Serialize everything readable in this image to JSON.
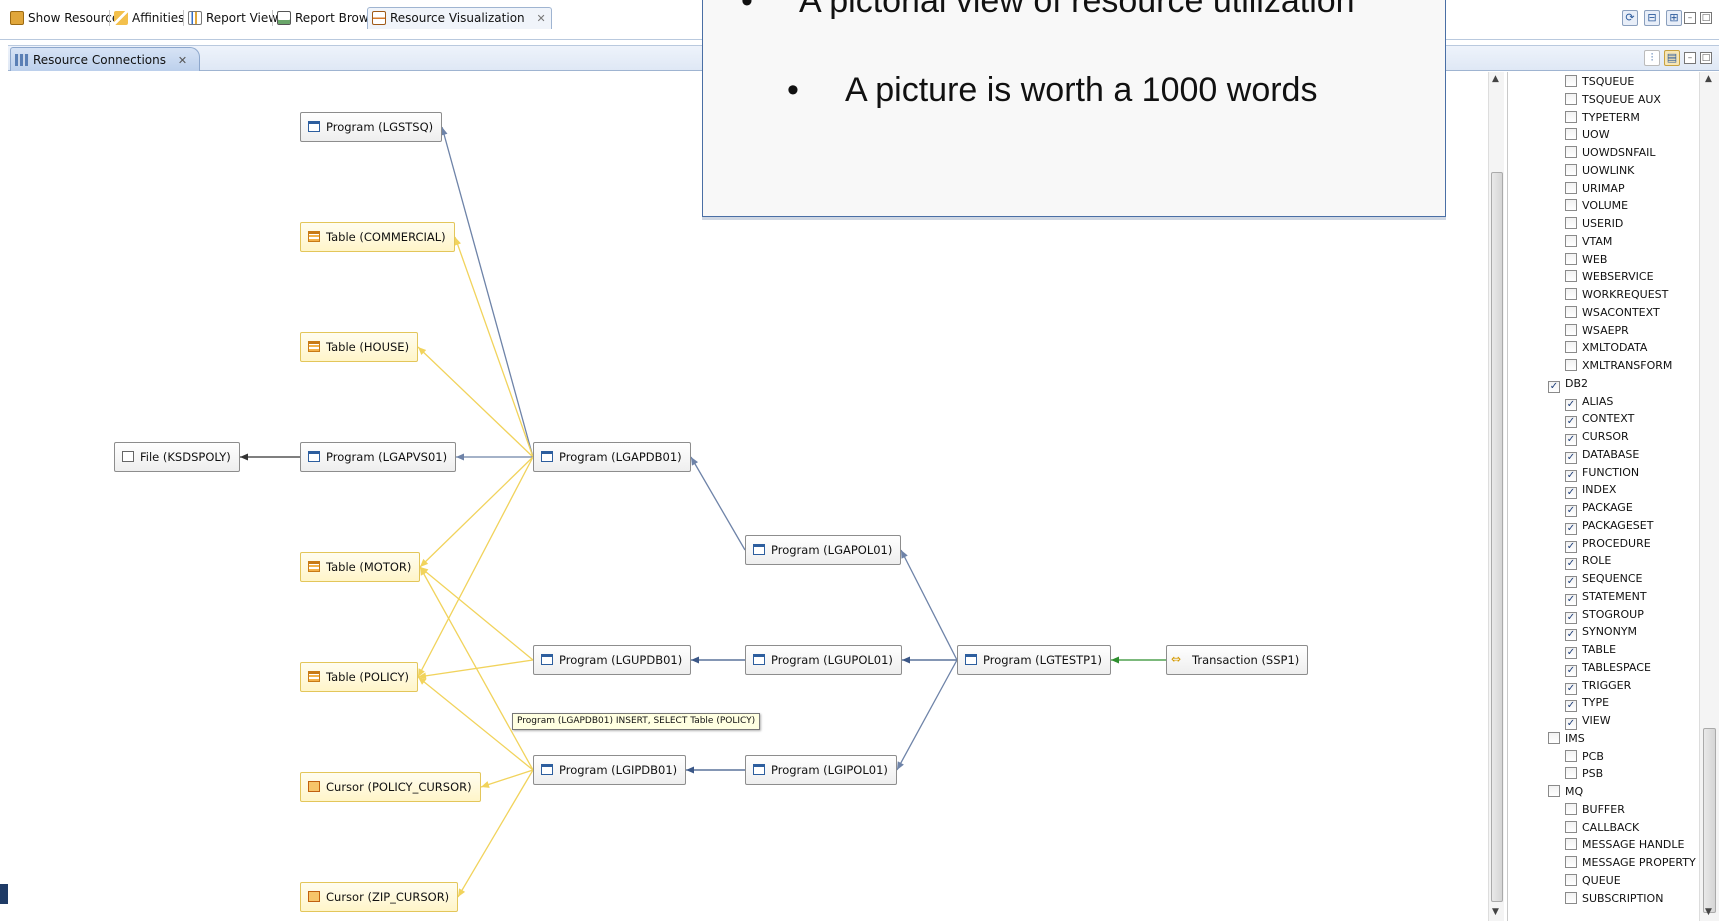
{
  "top_tabs": [
    {
      "label": "Show Resources",
      "icon": "show-resources-icon",
      "color": "#c78a1a"
    },
    {
      "label": "Affinities",
      "icon": "affinities-icon",
      "color": "#d99a1a"
    },
    {
      "label": "Report View",
      "icon": "report-view-icon",
      "color": "#2d6bc7"
    },
    {
      "label": "Report Browser",
      "icon": "report-browser-icon",
      "color": "#3f7f3f"
    },
    {
      "label": "Resource Visualization",
      "icon": "resource-visualization-icon",
      "color": "#c0722a",
      "active": true
    }
  ],
  "view_tab": {
    "label": "Resource Connections"
  },
  "overlay": {
    "bullets": [
      "A pictorial view of resource utilization",
      "A picture is worth a 1000 words"
    ]
  },
  "nodes": [
    {
      "id": "lgstsq",
      "label": "Program (LGSTSQ)",
      "kind": "program"
    },
    {
      "id": "commercial",
      "label": "Table (COMMERCIAL)",
      "kind": "table"
    },
    {
      "id": "house",
      "label": "Table (HOUSE)",
      "kind": "table"
    },
    {
      "id": "ksdspoly",
      "label": "File (KSDSPOLY)",
      "kind": "file"
    },
    {
      "id": "lgapvs01",
      "label": "Program (LGAPVS01)",
      "kind": "program"
    },
    {
      "id": "lgapdb01",
      "label": "Program (LGAPDB01)",
      "kind": "program"
    },
    {
      "id": "motor",
      "label": "Table (MOTOR)",
      "kind": "table"
    },
    {
      "id": "lgapol01",
      "label": "Program (LGAPOL01)",
      "kind": "program"
    },
    {
      "id": "policy",
      "label": "Table (POLICY)",
      "kind": "table"
    },
    {
      "id": "lgupdb01",
      "label": "Program (LGUPDB01)",
      "kind": "program"
    },
    {
      "id": "lgupol01",
      "label": "Program (LGUPOL01)",
      "kind": "program"
    },
    {
      "id": "lgtestp1",
      "label": "Program (LGTESTP1)",
      "kind": "program"
    },
    {
      "id": "ssp1",
      "label": "Transaction (SSP1)",
      "kind": "transaction"
    },
    {
      "id": "policy_cursor",
      "label": "Cursor (POLICY_CURSOR)",
      "kind": "cursor"
    },
    {
      "id": "lgipdb01",
      "label": "Program (LGIPDB01)",
      "kind": "program"
    },
    {
      "id": "lgipol01",
      "label": "Program (LGIPOL01)",
      "kind": "program"
    },
    {
      "id": "zip_cursor",
      "label": "Cursor (ZIP_CURSOR)",
      "kind": "cursor"
    }
  ],
  "edges": [
    {
      "from": "lgapdb01",
      "to": "lgstsq",
      "color": "#6e83a8"
    },
    {
      "from": "lgapdb01",
      "to": "commercial",
      "color": "#f1d35c"
    },
    {
      "from": "lgapdb01",
      "to": "house",
      "color": "#f1d35c"
    },
    {
      "from": "lgapdb01",
      "to": "lgapvs01",
      "color": "#6e83a8"
    },
    {
      "from": "lgapvs01",
      "to": "ksdspoly",
      "color": "#333333"
    },
    {
      "from": "lgapdb01",
      "to": "motor",
      "color": "#f1d35c"
    },
    {
      "from": "lgapdb01",
      "to": "policy",
      "color": "#f1d35c"
    },
    {
      "from": "lgapol01",
      "to": "lgapdb01",
      "color": "#6e83a8"
    },
    {
      "from": "lgupdb01",
      "to": "motor",
      "color": "#f1d35c"
    },
    {
      "from": "lgupdb01",
      "to": "policy",
      "color": "#f1d35c"
    },
    {
      "from": "lgupol01",
      "to": "lgupdb01",
      "color": "#3b5787"
    },
    {
      "from": "lgtestp1",
      "to": "lgupol01",
      "color": "#3b5787"
    },
    {
      "from": "lgtestp1",
      "to": "lgapol01",
      "color": "#6e83a8"
    },
    {
      "from": "lgtestp1",
      "to": "lgipol01",
      "color": "#6e83a8"
    },
    {
      "from": "ssp1",
      "to": "lgtestp1",
      "color": "#2f8f2f"
    },
    {
      "from": "lgipdb01",
      "to": "policy",
      "color": "#f1d35c"
    },
    {
      "from": "lgipdb01",
      "to": "motor",
      "color": "#f1d35c"
    },
    {
      "from": "lgipdb01",
      "to": "policy_cursor",
      "color": "#f1d35c"
    },
    {
      "from": "lgipdb01",
      "to": "zip_cursor",
      "color": "#f1d35c"
    },
    {
      "from": "lgipol01",
      "to": "lgipdb01",
      "color": "#3b5787"
    }
  ],
  "tooltip": {
    "text": "Program (LGAPDB01) INSERT, SELECT Table (POLICY)"
  },
  "tree": [
    {
      "label": "TSQUEUE",
      "level": 1,
      "checked": false
    },
    {
      "label": "TSQUEUE AUX",
      "level": 1,
      "checked": false
    },
    {
      "label": "TYPETERM",
      "level": 1,
      "checked": false
    },
    {
      "label": "UOW",
      "level": 1,
      "checked": false
    },
    {
      "label": "UOWDSNFAIL",
      "level": 1,
      "checked": false
    },
    {
      "label": "UOWLINK",
      "level": 1,
      "checked": false
    },
    {
      "label": "URIMAP",
      "level": 1,
      "checked": false
    },
    {
      "label": "VOLUME",
      "level": 1,
      "checked": false
    },
    {
      "label": "USERID",
      "level": 1,
      "checked": false
    },
    {
      "label": "VTAM",
      "level": 1,
      "checked": false
    },
    {
      "label": "WEB",
      "level": 1,
      "checked": false
    },
    {
      "label": "WEBSERVICE",
      "level": 1,
      "checked": false
    },
    {
      "label": "WORKREQUEST",
      "level": 1,
      "checked": false
    },
    {
      "label": "WSACONTEXT",
      "level": 1,
      "checked": false
    },
    {
      "label": "WSAEPR",
      "level": 1,
      "checked": false
    },
    {
      "label": "XMLTODATA",
      "level": 1,
      "checked": false
    },
    {
      "label": "XMLTRANSFORM",
      "level": 1,
      "checked": false
    },
    {
      "label": "DB2",
      "level": 0,
      "checked": true
    },
    {
      "label": "ALIAS",
      "level": 1,
      "checked": true
    },
    {
      "label": "CONTEXT",
      "level": 1,
      "checked": true
    },
    {
      "label": "CURSOR",
      "level": 1,
      "checked": true
    },
    {
      "label": "DATABASE",
      "level": 1,
      "checked": true
    },
    {
      "label": "FUNCTION",
      "level": 1,
      "checked": true
    },
    {
      "label": "INDEX",
      "level": 1,
      "checked": true
    },
    {
      "label": "PACKAGE",
      "level": 1,
      "checked": true
    },
    {
      "label": "PACKAGESET",
      "level": 1,
      "checked": true
    },
    {
      "label": "PROCEDURE",
      "level": 1,
      "checked": true
    },
    {
      "label": "ROLE",
      "level": 1,
      "checked": true
    },
    {
      "label": "SEQUENCE",
      "level": 1,
      "checked": true
    },
    {
      "label": "STATEMENT",
      "level": 1,
      "checked": true
    },
    {
      "label": "STOGROUP",
      "level": 1,
      "checked": true
    },
    {
      "label": "SYNONYM",
      "level": 1,
      "checked": true
    },
    {
      "label": "TABLE",
      "level": 1,
      "checked": true
    },
    {
      "label": "TABLESPACE",
      "level": 1,
      "checked": true
    },
    {
      "label": "TRIGGER",
      "level": 1,
      "checked": true
    },
    {
      "label": "TYPE",
      "level": 1,
      "checked": true
    },
    {
      "label": "VIEW",
      "level": 1,
      "checked": true
    },
    {
      "label": "IMS",
      "level": 0,
      "checked": false
    },
    {
      "label": "PCB",
      "level": 1,
      "checked": false
    },
    {
      "label": "PSB",
      "level": 1,
      "checked": false
    },
    {
      "label": "MQ",
      "level": 0,
      "checked": false
    },
    {
      "label": "BUFFER",
      "level": 1,
      "checked": false
    },
    {
      "label": "CALLBACK",
      "level": 1,
      "checked": false
    },
    {
      "label": "MESSAGE HANDLE",
      "level": 1,
      "checked": false
    },
    {
      "label": "MESSAGE PROPERTY",
      "level": 1,
      "checked": false
    },
    {
      "label": "QUEUE",
      "level": 1,
      "checked": false
    },
    {
      "label": "SUBSCRIPTION",
      "level": 1,
      "checked": false
    }
  ]
}
